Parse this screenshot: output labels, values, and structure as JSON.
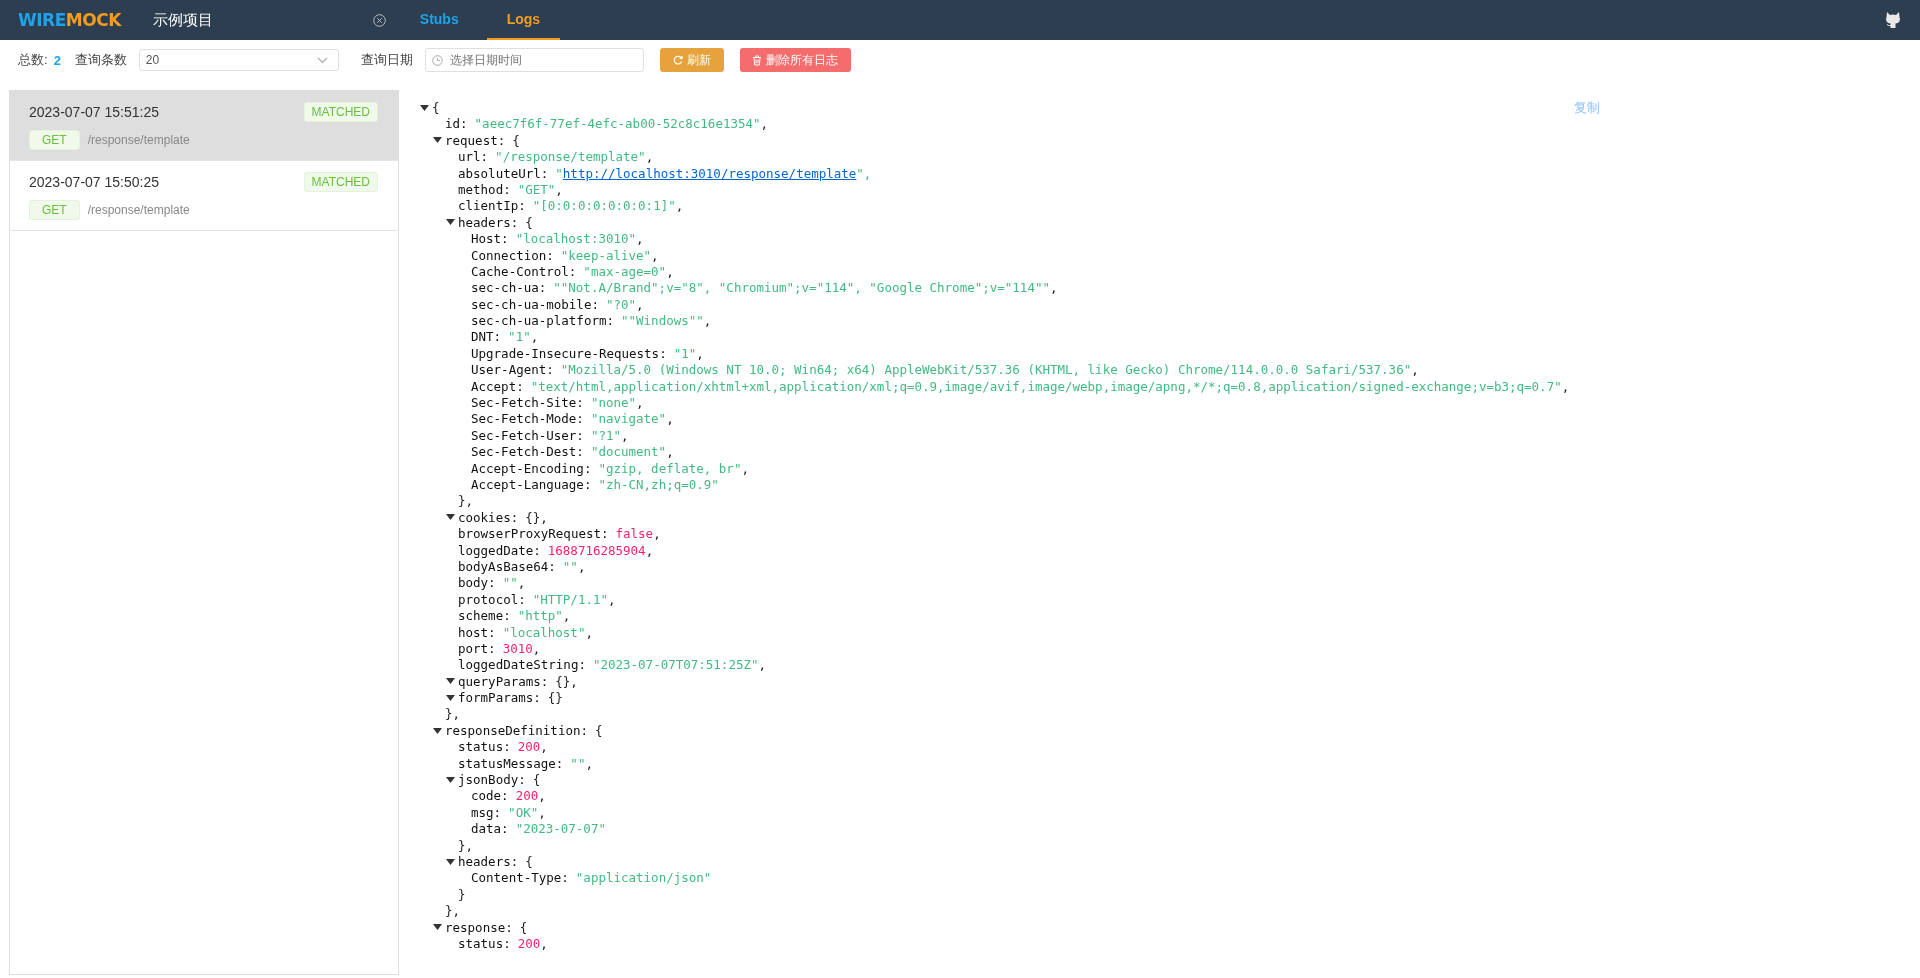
{
  "header": {
    "logo": {
      "first": "WIRE",
      "second": "MOCK"
    },
    "project": "示例项目",
    "tabs": [
      {
        "label": "Stubs",
        "selected": false
      },
      {
        "label": "Logs",
        "selected": true
      }
    ]
  },
  "toolbar": {
    "total_label": "总数:",
    "total": "2",
    "limit_label": "查询条数",
    "limit_value": "20",
    "date_label": "查询日期",
    "date_placeholder": "选择日期时间",
    "refresh": "刷新",
    "delete_all": "删除所有日志"
  },
  "requests": [
    {
      "time": "2023-07-07 15:51:25",
      "status": "MATCHED",
      "method": "GET",
      "path": "/response/template",
      "selected": true
    },
    {
      "time": "2023-07-07 15:50:25",
      "status": "MATCHED",
      "method": "GET",
      "path": "/response/template",
      "selected": false
    }
  ],
  "detail": {
    "copy": "复制",
    "tree": {
      "open": "{",
      "expanded": true,
      "children": [
        {
          "key": "id:",
          "value": "\"aeec7f6f-77ef-4efc-ab00-52c8c16e1354\"",
          "kind": "string",
          "after": ","
        },
        {
          "key": "request:",
          "open": "{",
          "expanded": true,
          "close": "},",
          "children": [
            {
              "key": "url:",
              "value": "\"/response/template\"",
              "kind": "string",
              "after": ","
            },
            {
              "key": "absoluteUrl:",
              "before": "\"",
              "value": "http://localhost:3010/response/template",
              "kind": "link",
              "after": "\","
            },
            {
              "key": "method:",
              "value": "\"GET\"",
              "kind": "string",
              "after": ","
            },
            {
              "key": "clientIp:",
              "value": "\"[0:0:0:0:0:0:0:1]\"",
              "kind": "string",
              "after": ","
            },
            {
              "key": "headers:",
              "open": "{",
              "expanded": true,
              "close": "},",
              "children": [
                {
                  "key": "Host:",
                  "value": "\"localhost:3010\"",
                  "kind": "string",
                  "after": ","
                },
                {
                  "key": "Connection:",
                  "value": "\"keep-alive\"",
                  "kind": "string",
                  "after": ","
                },
                {
                  "key": "Cache-Control:",
                  "value": "\"max-age=0\"",
                  "kind": "string",
                  "after": ","
                },
                {
                  "key": "sec-ch-ua:",
                  "value": "\"\"Not.A/Brand\";v=\"8\", \"Chromium\";v=\"114\", \"Google Chrome\";v=\"114\"\"",
                  "kind": "string",
                  "after": ","
                },
                {
                  "key": "sec-ch-ua-mobile:",
                  "value": "\"?0\"",
                  "kind": "string",
                  "after": ","
                },
                {
                  "key": "sec-ch-ua-platform:",
                  "value": "\"\"Windows\"\"",
                  "kind": "string",
                  "after": ","
                },
                {
                  "key": "DNT:",
                  "value": "\"1\"",
                  "kind": "string",
                  "after": ","
                },
                {
                  "key": "Upgrade-Insecure-Requests:",
                  "value": "\"1\"",
                  "kind": "string",
                  "after": ","
                },
                {
                  "key": "User-Agent:",
                  "value": "\"Mozilla/5.0 (Windows NT 10.0; Win64; x64) AppleWebKit/537.36 (KHTML, like Gecko) Chrome/114.0.0.0 Safari/537.36\"",
                  "kind": "string",
                  "after": ","
                },
                {
                  "key": "Accept:",
                  "value": "\"text/html,application/xhtml+xml,application/xml;q=0.9,image/avif,image/webp,image/apng,*/*;q=0.8,application/signed-exchange;v=b3;q=0.7\"",
                  "kind": "string",
                  "after": ","
                },
                {
                  "key": "Sec-Fetch-Site:",
                  "value": "\"none\"",
                  "kind": "string",
                  "after": ","
                },
                {
                  "key": "Sec-Fetch-Mode:",
                  "value": "\"navigate\"",
                  "kind": "string",
                  "after": ","
                },
                {
                  "key": "Sec-Fetch-User:",
                  "value": "\"?1\"",
                  "kind": "string",
                  "after": ","
                },
                {
                  "key": "Sec-Fetch-Dest:",
                  "value": "\"document\"",
                  "kind": "string",
                  "after": ","
                },
                {
                  "key": "Accept-Encoding:",
                  "value": "\"gzip, deflate, br\"",
                  "kind": "string",
                  "after": ","
                },
                {
                  "key": "Accept-Language:",
                  "value": "\"zh-CN,zh;q=0.9\"",
                  "kind": "string"
                }
              ]
            },
            {
              "key": "cookies:",
              "open": "{},",
              "expanded": true
            },
            {
              "key": "browserProxyRequest:",
              "value": "false",
              "kind": "boolean",
              "after": ","
            },
            {
              "key": "loggedDate:",
              "value": "1688716285904",
              "kind": "number",
              "after": ","
            },
            {
              "key": "bodyAsBase64:",
              "value": "\"\"",
              "kind": "string",
              "after": ","
            },
            {
              "key": "body:",
              "value": "\"\"",
              "kind": "string",
              "after": ","
            },
            {
              "key": "protocol:",
              "value": "\"HTTP/1.1\"",
              "kind": "string",
              "after": ","
            },
            {
              "key": "scheme:",
              "value": "\"http\"",
              "kind": "string",
              "after": ","
            },
            {
              "key": "host:",
              "value": "\"localhost\"",
              "kind": "string",
              "after": ","
            },
            {
              "key": "port:",
              "value": "3010",
              "kind": "number",
              "after": ","
            },
            {
              "key": "loggedDateString:",
              "value": "\"2023-07-07T07:51:25Z\"",
              "kind": "string",
              "after": ","
            },
            {
              "key": "queryParams:",
              "open": "{},",
              "expanded": true
            },
            {
              "key": "formParams:",
              "open": "{}",
              "expanded": true
            }
          ]
        },
        {
          "key": "responseDefinition:",
          "open": "{",
          "expanded": true,
          "close": "},",
          "children": [
            {
              "key": "status:",
              "value": "200",
              "kind": "number",
              "after": ","
            },
            {
              "key": "statusMessage:",
              "value": "\"\"",
              "kind": "string",
              "after": ","
            },
            {
              "key": "jsonBody:",
              "open": "{",
              "expanded": true,
              "close": "},",
              "children": [
                {
                  "key": "code:",
                  "value": "200",
                  "kind": "number",
                  "after": ","
                },
                {
                  "key": "msg:",
                  "value": "\"OK\"",
                  "kind": "string",
                  "after": ","
                },
                {
                  "key": "data:",
                  "value": "\"2023-07-07\"",
                  "kind": "string"
                }
              ]
            },
            {
              "key": "headers:",
              "open": "{",
              "expanded": true,
              "close": "}",
              "children": [
                {
                  "key": "Content-Type:",
                  "value": "\"application/json\"",
                  "kind": "string"
                }
              ]
            }
          ]
        },
        {
          "key": "response:",
          "open": "{",
          "expanded": true,
          "children": [
            {
              "key": "status:",
              "value": "200",
              "kind": "number",
              "after": ","
            }
          ]
        }
      ]
    }
  }
}
